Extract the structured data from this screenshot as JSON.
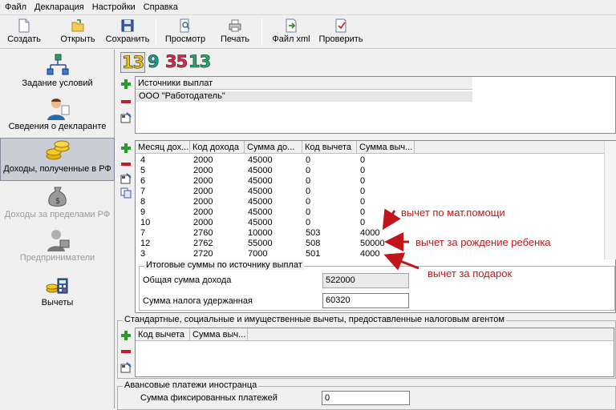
{
  "menu": [
    "Файл",
    "Декларация",
    "Настройки",
    "Справка"
  ],
  "toolbar": {
    "create": "Создать",
    "open": "Открыть",
    "save": "Сохранить",
    "preview": "Просмотр",
    "print": "Печать",
    "xml": "Файл xml",
    "check": "Проверить"
  },
  "sidebar": {
    "conditions": "Задание условий",
    "declarant": "Сведения о декларанте",
    "income_rf": "Доходы, полученные в РФ",
    "income_abroad": "Доходы за пределами РФ",
    "entrepreneurs": "Предприниматели",
    "deductions": "Вычеты"
  },
  "years": [
    "13",
    "9",
    "35",
    "13"
  ],
  "year_colors": [
    "#e8c21a",
    "#1f9e8a",
    "#d82a4e",
    "#1fae6a"
  ],
  "sources": {
    "header": "Источники выплат",
    "rows": [
      "ООО \"Работодатель\""
    ]
  },
  "income": {
    "columns": [
      "Месяц дох...",
      "Код дохода",
      "Сумма до...",
      "Код вычета",
      "Сумма выч..."
    ],
    "rows": [
      [
        "4",
        "2000",
        "45000",
        "0",
        "0"
      ],
      [
        "5",
        "2000",
        "45000",
        "0",
        "0"
      ],
      [
        "6",
        "2000",
        "45000",
        "0",
        "0"
      ],
      [
        "7",
        "2000",
        "45000",
        "0",
        "0"
      ],
      [
        "8",
        "2000",
        "45000",
        "0",
        "0"
      ],
      [
        "9",
        "2000",
        "45000",
        "0",
        "0"
      ],
      [
        "10",
        "2000",
        "45000",
        "0",
        "0"
      ],
      [
        "7",
        "2760",
        "10000",
        "503",
        "4000"
      ],
      [
        "12",
        "2762",
        "55000",
        "508",
        "50000"
      ],
      [
        "3",
        "2720",
        "7000",
        "501",
        "4000"
      ]
    ]
  },
  "totals": {
    "title": "Итоговые суммы по источнику выплат",
    "income_label": "Общая сумма дохода",
    "income_value": "522000",
    "tax_label": "Сумма налога удержанная",
    "tax_value": "60320"
  },
  "std": {
    "title": "Стандартные, социальные и имущественные вычеты, предоставленные налоговым агентом",
    "columns": [
      "Код вычета",
      "Сумма выч..."
    ]
  },
  "advance": {
    "title": "Авансовые платежи иностранца",
    "label": "Сумма фиксированных платежей",
    "value": "0"
  },
  "annotations": {
    "matpomosh": "вычет по мат.помощи",
    "child": "вычет за рождение ребенка",
    "gift": "вычет за подарок"
  },
  "colors": {
    "accent_red": "#c0161b",
    "add_green": "#2a9a2a"
  }
}
